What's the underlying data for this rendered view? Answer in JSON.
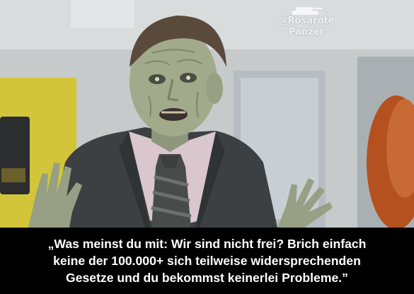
{
  "watermark": {
    "handle": "@Rosarote",
    "name": "Panzer",
    "icon": "tank-icon"
  },
  "caption": {
    "lines": [
      "„Was meinst du mit: Wir sind nicht frei? Brich einfach",
      "keine der 100.000+ sich teilweise widersprechenden",
      "Gesetze und du bekommst keinerlei Probleme.”"
    ],
    "color": "#ffffff",
    "background": "#000000"
  },
  "photo": {
    "subject": "zombie-man-in-suit",
    "colors": {
      "wall": "#c4c8c8",
      "skin": "#9ea68a",
      "suit": "#3e4244",
      "shirt": "#d8c6cc",
      "tie": "#4a4d4c",
      "yellow_sign": "#d6c93a",
      "orange_hair": "#b8521e"
    }
  }
}
